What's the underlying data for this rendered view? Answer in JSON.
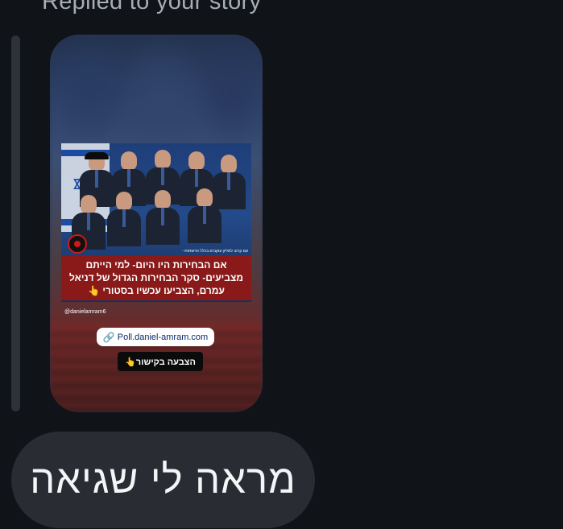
{
  "thread": {
    "replied_label": "Replied to your story"
  },
  "story": {
    "source_strip": "עם קרוב למליון עוקבים בכלל הרשתות -",
    "headline": "אם הבחירות היו היום- למי הייתם מצביעים- סקר הבחירות הגדול של דניאל עמרם, הצביעו עכשיו בסטורי 👆",
    "handle": "@danielamram6",
    "link_icon": "link-icon",
    "link_text": "Poll.daniel-amram.com",
    "vote_button": "הצבעה בקישור👆"
  },
  "message": {
    "text": "מראה לי שגיאה"
  },
  "colors": {
    "background": "#101317",
    "bubble": "#292d33",
    "banner": "#8a1a1a",
    "link_blue": "#1a8cff"
  }
}
